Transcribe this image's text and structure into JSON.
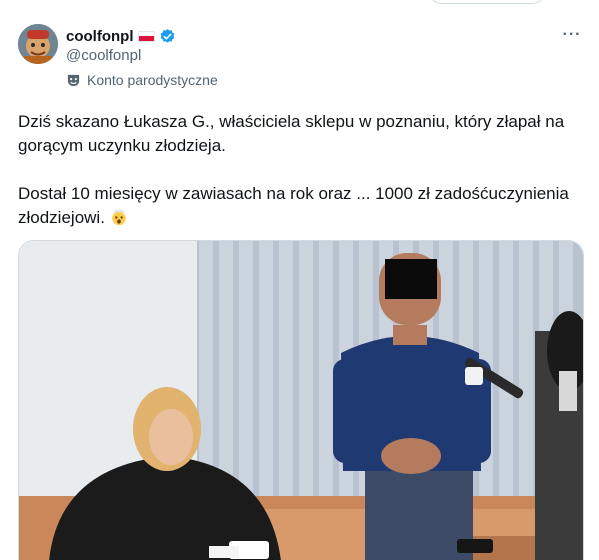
{
  "post": {
    "author": {
      "display_name": "coolfonpl",
      "handle": "@coolfonpl",
      "label": "Konto parodystyczne",
      "flag": "poland-flag",
      "verified": "verified-badge-icon"
    },
    "more_label": "···",
    "text": "Dziś skazano Łukasza G., właściciela sklepu w poznaniu, który złapał na gorącym uczynku złodzieja.\n\nDostał 10 miesięcy w zawiasach na rok oraz ... 1000 zł zadośćuczynienia złodziejowi.",
    "emoji": "exploding-head-emoji",
    "media": {
      "description_icon": "courtroom-photo"
    }
  },
  "colors": {
    "text_primary": "#0f1419",
    "text_secondary": "#536471",
    "verified_blue": "#1d9bf0",
    "border": "#cfd9de"
  }
}
